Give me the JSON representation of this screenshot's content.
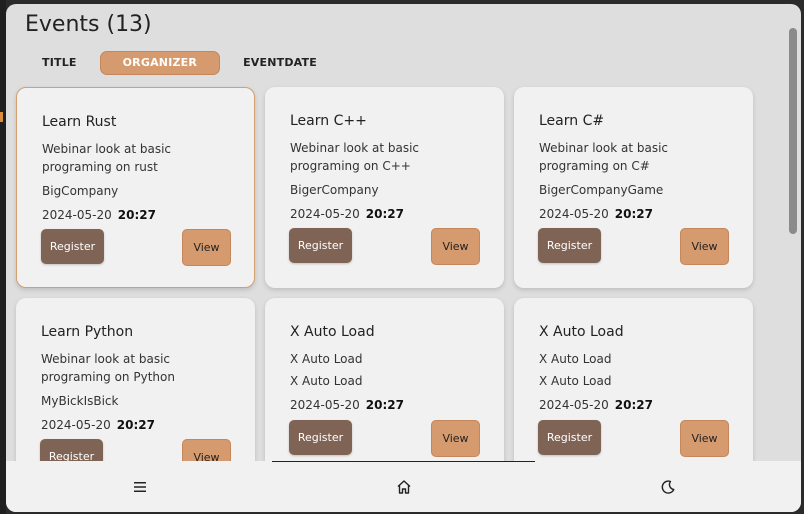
{
  "page": {
    "title": "Events (13)"
  },
  "tabs": [
    {
      "label": "TITLE",
      "active": false
    },
    {
      "label": "ORGANIZER",
      "active": true
    },
    {
      "label": "EVENTDATE",
      "active": false
    }
  ],
  "events": [
    {
      "title": "Learn Rust",
      "description": "Webinar look at basic programing on rust",
      "organizer": "BigCompany",
      "date": "2024-05-20",
      "time": "20:27",
      "register_label": "Register",
      "view_label": "View"
    },
    {
      "title": "Learn C++",
      "description": "Webinar look at basic programing on C++",
      "organizer": "BigerCompany",
      "date": "2024-05-20",
      "time": "20:27",
      "register_label": "Register",
      "view_label": "View"
    },
    {
      "title": "Learn C#",
      "description": "Webinar look at basic programing on C#",
      "organizer": "BigerCompanyGame",
      "date": "2024-05-20",
      "time": "20:27",
      "register_label": "Register",
      "view_label": "View"
    },
    {
      "title": "Learn Python",
      "description": "Webinar look at basic programing on Python",
      "organizer": "MyBickIsBick",
      "date": "2024-05-20",
      "time": "20:27",
      "register_label": "Register",
      "view_label": "View"
    },
    {
      "title": "X Auto Load",
      "description": "X Auto Load",
      "organizer": "X Auto Load",
      "date": "2024-05-20",
      "time": "20:27",
      "register_label": "Register",
      "view_label": "View"
    },
    {
      "title": "X Auto Load",
      "description": "X Auto Load",
      "organizer": "X Auto Load",
      "date": "2024-05-20",
      "time": "20:27",
      "register_label": "Register",
      "view_label": "View"
    }
  ],
  "bottom_nav": {
    "menu_icon": "menu-icon",
    "home_icon": "home-icon",
    "theme_icon": "moon-icon"
  },
  "colors": {
    "accent": "#d59a6d",
    "register": "#7f6455",
    "card": "#f1f1f1",
    "background": "#dedede"
  }
}
